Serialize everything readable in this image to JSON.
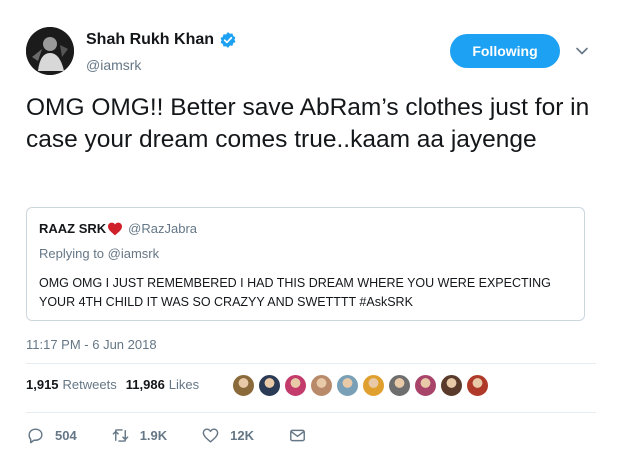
{
  "author": {
    "display_name": "Shah Rukh Khan",
    "handle": "@iamsrk",
    "verified": true,
    "avatar_icon": "profile-photo"
  },
  "follow_button": {
    "label": "Following",
    "color": "#1da1f2"
  },
  "tweet": {
    "text": "OMG OMG!! Better save AbRam’s clothes just for in case your dream comes true..kaam aa jayenge"
  },
  "quoted_tweet": {
    "display_name": "RAAZ SRK",
    "handle": "@RazJabra",
    "replying_to": "Replying to @iamsrk",
    "text": "OMG OMG I JUST REMEMBERED I HAD THIS DREAM WHERE YOU WERE EXPECTING YOUR 4TH CHILD IT WAS SO CRAZYY AND SWETTTT #AskSRK"
  },
  "timestamp": "11:17 PM - 6 Jun 2018",
  "stats": {
    "retweets_count": "1,915",
    "retweets_label": "Retweets",
    "likes_count": "11,986",
    "likes_label": "Likes"
  },
  "likers_avatars": [
    "#8a6a3a",
    "#2b3a55",
    "#c23b6b",
    "#b98a6a",
    "#7aa0b8",
    "#e0a030",
    "#6e6e6e",
    "#a8446a",
    "#5a3a2a",
    "#b03a2a"
  ],
  "actions": {
    "replies": "504",
    "retweets": "1.9K",
    "likes": "12K"
  },
  "colors": {
    "text_primary": "#14171a",
    "text_secondary": "#657786",
    "border": "#ccd6dd",
    "accent": "#1da1f2",
    "heart": "#e0245e"
  }
}
